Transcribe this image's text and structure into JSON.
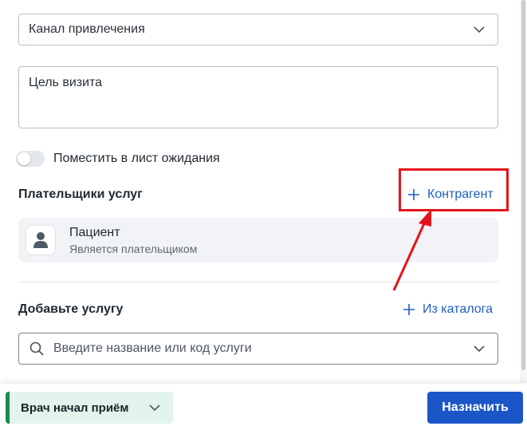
{
  "acquisition_channel": {
    "label": "Канал привлечения",
    "icon": "chevron-down-icon"
  },
  "visit_purpose": {
    "placeholder": "Цель визита"
  },
  "waitlist": {
    "label": "Поместить в лист ожидания",
    "enabled": false
  },
  "payers": {
    "title": "Плательщики услуг",
    "add_contractor_label": "Контрагент",
    "add_icon": "plus-icon",
    "items": [
      {
        "name": "Пациент",
        "subtitle": "Является плательщиком",
        "icon": "user-icon"
      }
    ]
  },
  "services": {
    "title": "Добавьте услугу",
    "catalog_label": "Из каталога",
    "search_placeholder": "Введите название или код услуги",
    "search_icon": "search-icon"
  },
  "footer": {
    "status_label": "Врач начал приём",
    "assign_label": "Назначить"
  },
  "colors": {
    "accent": "#1b56c9",
    "link": "#1f5fbf",
    "status_green": "#1a8a52",
    "highlight_red": "#e3141b"
  }
}
